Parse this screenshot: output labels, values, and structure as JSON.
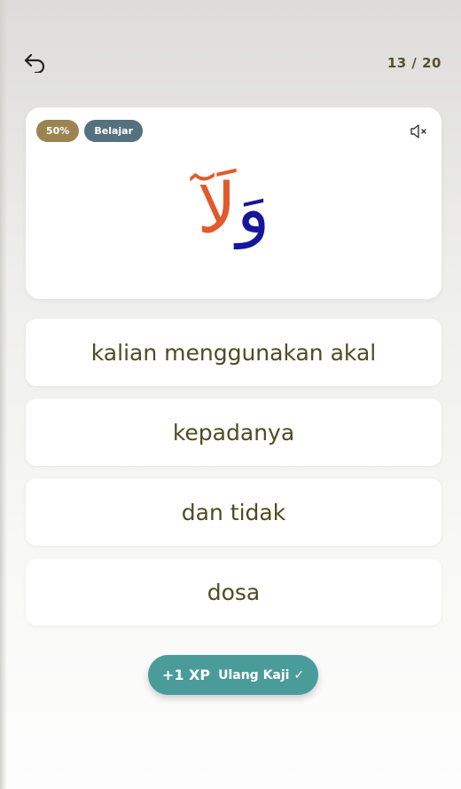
{
  "header": {
    "back_icon": "undo-arrow-icon",
    "progress_label": "13 / 20"
  },
  "card": {
    "percent_badge": "50%",
    "mode_badge": "Belajar",
    "mute_icon": "speaker-muted-icon",
    "arabic": {
      "waw": "وَ",
      "lam_alif": "لَآ"
    },
    "colors": {
      "waw": "#17169b",
      "lam_alif": "#e05a2c",
      "percent_badge": "#9b8352",
      "mode_badge": "#55707e"
    }
  },
  "options": [
    {
      "label": "kalian menggunakan akal"
    },
    {
      "label": "kepadanya"
    },
    {
      "label": "dan tidak"
    },
    {
      "label": "dosa"
    }
  ],
  "review_button": {
    "xp": "+1 XP",
    "label": "Ulang Kaji ✓",
    "color": "#4a9c9a"
  }
}
